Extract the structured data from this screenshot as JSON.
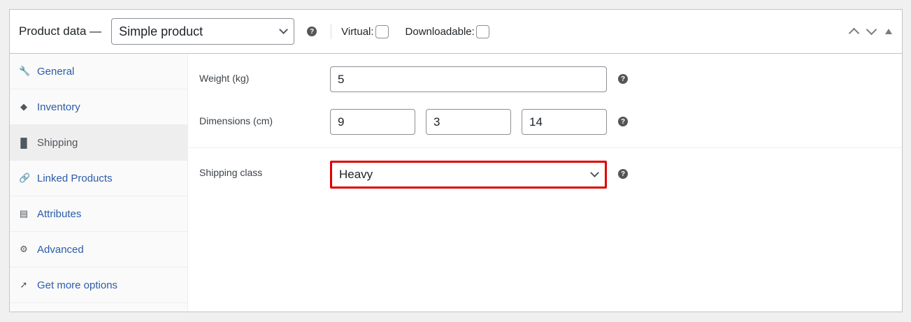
{
  "header": {
    "title": "Product data —",
    "product_type": "Simple product",
    "virtual_label": "Virtual:",
    "downloadable_label": "Downloadable:",
    "help": "?"
  },
  "sidebar": {
    "items": [
      {
        "label": "General",
        "icon": "wrench-icon"
      },
      {
        "label": "Inventory",
        "icon": "tag-icon"
      },
      {
        "label": "Shipping",
        "icon": "truck-icon"
      },
      {
        "label": "Linked Products",
        "icon": "link-icon"
      },
      {
        "label": "Attributes",
        "icon": "list-icon"
      },
      {
        "label": "Advanced",
        "icon": "gear-icon"
      },
      {
        "label": "Get more options",
        "icon": "plugin-icon"
      }
    ]
  },
  "shipping": {
    "weight_label": "Weight (kg)",
    "weight": "5",
    "dimensions_label": "Dimensions (cm)",
    "length": "9",
    "width": "3",
    "height": "14",
    "class_label": "Shipping class",
    "class_value": "Heavy"
  },
  "colors": {
    "highlight": "#e00000"
  }
}
